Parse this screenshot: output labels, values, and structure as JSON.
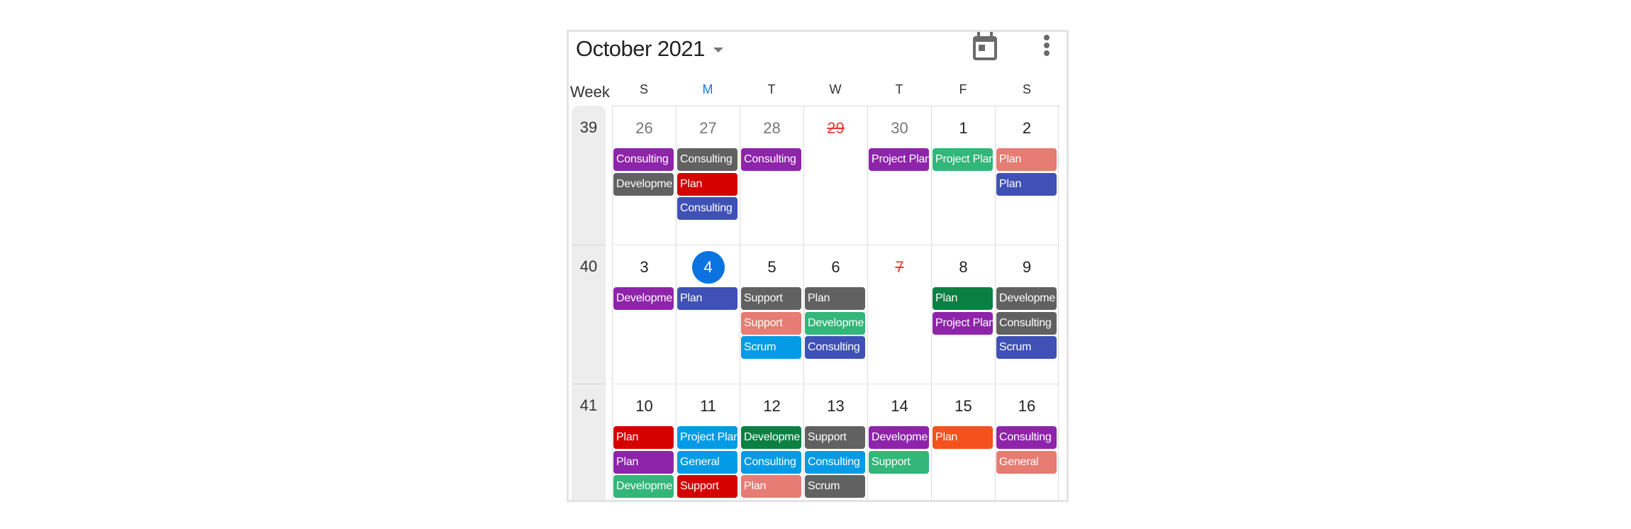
{
  "header": {
    "title": "October 2021",
    "icons": [
      "calendar-today-icon",
      "more-vertical-icon"
    ]
  },
  "week_label": "Week",
  "days_of_week": [
    {
      "label": "S",
      "today": false
    },
    {
      "label": "M",
      "today": true
    },
    {
      "label": "T",
      "today": false
    },
    {
      "label": "W",
      "today": false
    },
    {
      "label": "T",
      "today": false
    },
    {
      "label": "F",
      "today": false
    },
    {
      "label": "S",
      "today": false
    }
  ],
  "colors": {
    "purple": "#8e24aa",
    "gray": "#616161",
    "red": "#d50000",
    "indigo": "#3f51b5",
    "green": "#33b679",
    "darkgreen": "#0b8043",
    "salmon": "#e67c73",
    "blue": "#039be5",
    "orange": "#f4511e",
    "today": "#0a73e0",
    "holiday": "#e53935"
  },
  "weeks": [
    {
      "number": "39",
      "days": [
        {
          "date": "26",
          "state": "other",
          "events": [
            {
              "title": "Consulting",
              "color": "purple"
            },
            {
              "title": "Developme",
              "color": "gray"
            }
          ]
        },
        {
          "date": "27",
          "state": "other",
          "events": [
            {
              "title": "Consulting",
              "color": "gray"
            },
            {
              "title": "Plan",
              "color": "red"
            },
            {
              "title": "Consulting",
              "color": "indigo"
            }
          ]
        },
        {
          "date": "28",
          "state": "other",
          "events": [
            {
              "title": "Consulting",
              "color": "purple"
            }
          ]
        },
        {
          "date": "29",
          "state": "holiday",
          "events": []
        },
        {
          "date": "30",
          "state": "other",
          "events": [
            {
              "title": "Project Plan",
              "color": "purple"
            }
          ]
        },
        {
          "date": "1",
          "state": "normal",
          "events": [
            {
              "title": "Project Plan",
              "color": "green"
            }
          ]
        },
        {
          "date": "2",
          "state": "normal",
          "events": [
            {
              "title": "Plan",
              "color": "salmon"
            },
            {
              "title": "Plan",
              "color": "indigo"
            }
          ]
        }
      ]
    },
    {
      "number": "40",
      "days": [
        {
          "date": "3",
          "state": "normal",
          "events": [
            {
              "title": "Developme",
              "color": "purple"
            }
          ]
        },
        {
          "date": "4",
          "state": "today",
          "events": [
            {
              "title": "Plan",
              "color": "indigo"
            }
          ]
        },
        {
          "date": "5",
          "state": "normal",
          "events": [
            {
              "title": "Support",
              "color": "gray"
            },
            {
              "title": "Support",
              "color": "salmon"
            },
            {
              "title": "Scrum",
              "color": "blue"
            }
          ]
        },
        {
          "date": "6",
          "state": "normal",
          "events": [
            {
              "title": "Plan",
              "color": "gray"
            },
            {
              "title": "Developme",
              "color": "green"
            },
            {
              "title": "Consulting",
              "color": "indigo"
            }
          ]
        },
        {
          "date": "7",
          "state": "holiday",
          "events": []
        },
        {
          "date": "8",
          "state": "normal",
          "events": [
            {
              "title": "Plan",
              "color": "darkgreen"
            },
            {
              "title": "Project Plan",
              "color": "purple"
            }
          ]
        },
        {
          "date": "9",
          "state": "normal",
          "events": [
            {
              "title": "Developme",
              "color": "gray"
            },
            {
              "title": "Consulting",
              "color": "gray"
            },
            {
              "title": "Scrum",
              "color": "indigo"
            }
          ]
        }
      ]
    },
    {
      "number": "41",
      "days": [
        {
          "date": "10",
          "state": "normal",
          "events": [
            {
              "title": "Plan",
              "color": "red"
            },
            {
              "title": "Plan",
              "color": "purple"
            },
            {
              "title": "Developme",
              "color": "green"
            }
          ]
        },
        {
          "date": "11",
          "state": "normal",
          "events": [
            {
              "title": "Project Plan",
              "color": "blue"
            },
            {
              "title": "General",
              "color": "blue"
            },
            {
              "title": "Support",
              "color": "red"
            }
          ]
        },
        {
          "date": "12",
          "state": "normal",
          "events": [
            {
              "title": "Developme",
              "color": "darkgreen"
            },
            {
              "title": "Consulting",
              "color": "blue"
            },
            {
              "title": "Plan",
              "color": "salmon"
            }
          ]
        },
        {
          "date": "13",
          "state": "normal",
          "events": [
            {
              "title": "Support",
              "color": "gray"
            },
            {
              "title": "Consulting",
              "color": "blue"
            },
            {
              "title": "Scrum",
              "color": "gray"
            }
          ]
        },
        {
          "date": "14",
          "state": "normal",
          "events": [
            {
              "title": "Developme",
              "color": "purple"
            },
            {
              "title": "Support",
              "color": "green"
            }
          ]
        },
        {
          "date": "15",
          "state": "normal",
          "events": [
            {
              "title": "Plan",
              "color": "orange"
            }
          ]
        },
        {
          "date": "16",
          "state": "normal",
          "events": [
            {
              "title": "Consulting",
              "color": "purple"
            },
            {
              "title": "General",
              "color": "salmon"
            }
          ]
        }
      ]
    }
  ]
}
